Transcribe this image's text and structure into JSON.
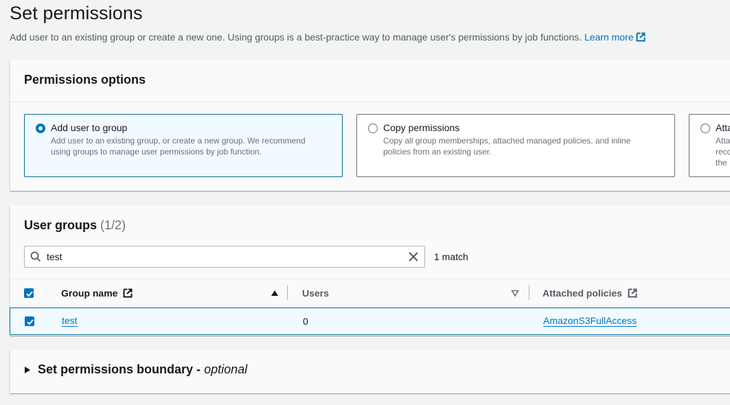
{
  "header": {
    "title": "Set permissions",
    "description": "Add user to an existing group or create a new one. Using groups is a best-practice way to manage user's permissions by job functions.",
    "learn_more": "Learn more"
  },
  "permissions_options": {
    "title": "Permissions options",
    "options": [
      {
        "label": "Add user to group",
        "description_line1": "Add user to an existing group, or create a new group. We recommend",
        "description_line2": "using groups to manage user permissions by job function.",
        "selected": true
      },
      {
        "label": "Copy permissions",
        "description_line1": "Copy all group memberships, attached managed policies, and inline",
        "description_line2": "policies from an existing user.",
        "selected": false
      },
      {
        "label": "Atta",
        "description_line1": "Atta",
        "description_line2": "reco",
        "description_line3": "the",
        "selected": false
      }
    ]
  },
  "user_groups": {
    "title": "User groups",
    "count": "(1/2)",
    "search": {
      "value": "test",
      "placeholder": "",
      "match_text": "1 match"
    },
    "columns": [
      {
        "label": "Group name",
        "sort": "ascending"
      },
      {
        "label": "Users",
        "sort": "descending-inactive"
      },
      {
        "label": "Attached policies"
      }
    ],
    "rows": [
      {
        "selected": true,
        "group_name": "test",
        "users": "0",
        "attached_policies": "AmazonS3FullAccess"
      }
    ]
  },
  "boundary": {
    "title": "Set permissions boundary - ",
    "optional": "optional"
  },
  "colors": {
    "accent": "#0073bb",
    "selected_bg": "#f1faff",
    "selected_border": "#0a6b8a"
  }
}
